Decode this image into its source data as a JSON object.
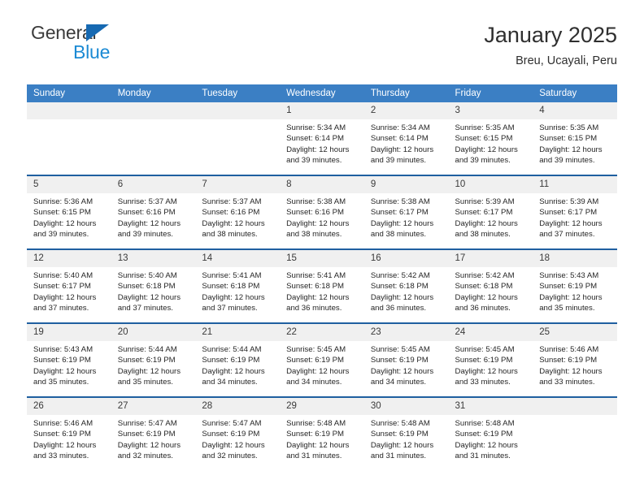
{
  "brand": {
    "name_part1": "General",
    "name_part2": "Blue",
    "triangle_color": "#1669b2",
    "blue_color": "#1b8ad4"
  },
  "header": {
    "title": "January 2025",
    "subtitle": "Breu, Ucayali, Peru"
  },
  "theme": {
    "header_blue": "#3b7fc4",
    "row_rule_blue": "#1f5fa0",
    "daynum_band": "#f0f0f0"
  },
  "weekday_headers": [
    "Sunday",
    "Monday",
    "Tuesday",
    "Wednesday",
    "Thursday",
    "Friday",
    "Saturday"
  ],
  "weeks": [
    [
      {
        "day": "",
        "sunrise": "",
        "sunset": "",
        "daylight_line1": "",
        "daylight_line2": ""
      },
      {
        "day": "",
        "sunrise": "",
        "sunset": "",
        "daylight_line1": "",
        "daylight_line2": ""
      },
      {
        "day": "",
        "sunrise": "",
        "sunset": "",
        "daylight_line1": "",
        "daylight_line2": ""
      },
      {
        "day": "1",
        "sunrise": "Sunrise: 5:34 AM",
        "sunset": "Sunset: 6:14 PM",
        "daylight_line1": "Daylight: 12 hours",
        "daylight_line2": "and 39 minutes."
      },
      {
        "day": "2",
        "sunrise": "Sunrise: 5:34 AM",
        "sunset": "Sunset: 6:14 PM",
        "daylight_line1": "Daylight: 12 hours",
        "daylight_line2": "and 39 minutes."
      },
      {
        "day": "3",
        "sunrise": "Sunrise: 5:35 AM",
        "sunset": "Sunset: 6:15 PM",
        "daylight_line1": "Daylight: 12 hours",
        "daylight_line2": "and 39 minutes."
      },
      {
        "day": "4",
        "sunrise": "Sunrise: 5:35 AM",
        "sunset": "Sunset: 6:15 PM",
        "daylight_line1": "Daylight: 12 hours",
        "daylight_line2": "and 39 minutes."
      }
    ],
    [
      {
        "day": "5",
        "sunrise": "Sunrise: 5:36 AM",
        "sunset": "Sunset: 6:15 PM",
        "daylight_line1": "Daylight: 12 hours",
        "daylight_line2": "and 39 minutes."
      },
      {
        "day": "6",
        "sunrise": "Sunrise: 5:37 AM",
        "sunset": "Sunset: 6:16 PM",
        "daylight_line1": "Daylight: 12 hours",
        "daylight_line2": "and 39 minutes."
      },
      {
        "day": "7",
        "sunrise": "Sunrise: 5:37 AM",
        "sunset": "Sunset: 6:16 PM",
        "daylight_line1": "Daylight: 12 hours",
        "daylight_line2": "and 38 minutes."
      },
      {
        "day": "8",
        "sunrise": "Sunrise: 5:38 AM",
        "sunset": "Sunset: 6:16 PM",
        "daylight_line1": "Daylight: 12 hours",
        "daylight_line2": "and 38 minutes."
      },
      {
        "day": "9",
        "sunrise": "Sunrise: 5:38 AM",
        "sunset": "Sunset: 6:17 PM",
        "daylight_line1": "Daylight: 12 hours",
        "daylight_line2": "and 38 minutes."
      },
      {
        "day": "10",
        "sunrise": "Sunrise: 5:39 AM",
        "sunset": "Sunset: 6:17 PM",
        "daylight_line1": "Daylight: 12 hours",
        "daylight_line2": "and 38 minutes."
      },
      {
        "day": "11",
        "sunrise": "Sunrise: 5:39 AM",
        "sunset": "Sunset: 6:17 PM",
        "daylight_line1": "Daylight: 12 hours",
        "daylight_line2": "and 37 minutes."
      }
    ],
    [
      {
        "day": "12",
        "sunrise": "Sunrise: 5:40 AM",
        "sunset": "Sunset: 6:17 PM",
        "daylight_line1": "Daylight: 12 hours",
        "daylight_line2": "and 37 minutes."
      },
      {
        "day": "13",
        "sunrise": "Sunrise: 5:40 AM",
        "sunset": "Sunset: 6:18 PM",
        "daylight_line1": "Daylight: 12 hours",
        "daylight_line2": "and 37 minutes."
      },
      {
        "day": "14",
        "sunrise": "Sunrise: 5:41 AM",
        "sunset": "Sunset: 6:18 PM",
        "daylight_line1": "Daylight: 12 hours",
        "daylight_line2": "and 37 minutes."
      },
      {
        "day": "15",
        "sunrise": "Sunrise: 5:41 AM",
        "sunset": "Sunset: 6:18 PM",
        "daylight_line1": "Daylight: 12 hours",
        "daylight_line2": "and 36 minutes."
      },
      {
        "day": "16",
        "sunrise": "Sunrise: 5:42 AM",
        "sunset": "Sunset: 6:18 PM",
        "daylight_line1": "Daylight: 12 hours",
        "daylight_line2": "and 36 minutes."
      },
      {
        "day": "17",
        "sunrise": "Sunrise: 5:42 AM",
        "sunset": "Sunset: 6:18 PM",
        "daylight_line1": "Daylight: 12 hours",
        "daylight_line2": "and 36 minutes."
      },
      {
        "day": "18",
        "sunrise": "Sunrise: 5:43 AM",
        "sunset": "Sunset: 6:19 PM",
        "daylight_line1": "Daylight: 12 hours",
        "daylight_line2": "and 35 minutes."
      }
    ],
    [
      {
        "day": "19",
        "sunrise": "Sunrise: 5:43 AM",
        "sunset": "Sunset: 6:19 PM",
        "daylight_line1": "Daylight: 12 hours",
        "daylight_line2": "and 35 minutes."
      },
      {
        "day": "20",
        "sunrise": "Sunrise: 5:44 AM",
        "sunset": "Sunset: 6:19 PM",
        "daylight_line1": "Daylight: 12 hours",
        "daylight_line2": "and 35 minutes."
      },
      {
        "day": "21",
        "sunrise": "Sunrise: 5:44 AM",
        "sunset": "Sunset: 6:19 PM",
        "daylight_line1": "Daylight: 12 hours",
        "daylight_line2": "and 34 minutes."
      },
      {
        "day": "22",
        "sunrise": "Sunrise: 5:45 AM",
        "sunset": "Sunset: 6:19 PM",
        "daylight_line1": "Daylight: 12 hours",
        "daylight_line2": "and 34 minutes."
      },
      {
        "day": "23",
        "sunrise": "Sunrise: 5:45 AM",
        "sunset": "Sunset: 6:19 PM",
        "daylight_line1": "Daylight: 12 hours",
        "daylight_line2": "and 34 minutes."
      },
      {
        "day": "24",
        "sunrise": "Sunrise: 5:45 AM",
        "sunset": "Sunset: 6:19 PM",
        "daylight_line1": "Daylight: 12 hours",
        "daylight_line2": "and 33 minutes."
      },
      {
        "day": "25",
        "sunrise": "Sunrise: 5:46 AM",
        "sunset": "Sunset: 6:19 PM",
        "daylight_line1": "Daylight: 12 hours",
        "daylight_line2": "and 33 minutes."
      }
    ],
    [
      {
        "day": "26",
        "sunrise": "Sunrise: 5:46 AM",
        "sunset": "Sunset: 6:19 PM",
        "daylight_line1": "Daylight: 12 hours",
        "daylight_line2": "and 33 minutes."
      },
      {
        "day": "27",
        "sunrise": "Sunrise: 5:47 AM",
        "sunset": "Sunset: 6:19 PM",
        "daylight_line1": "Daylight: 12 hours",
        "daylight_line2": "and 32 minutes."
      },
      {
        "day": "28",
        "sunrise": "Sunrise: 5:47 AM",
        "sunset": "Sunset: 6:19 PM",
        "daylight_line1": "Daylight: 12 hours",
        "daylight_line2": "and 32 minutes."
      },
      {
        "day": "29",
        "sunrise": "Sunrise: 5:48 AM",
        "sunset": "Sunset: 6:19 PM",
        "daylight_line1": "Daylight: 12 hours",
        "daylight_line2": "and 31 minutes."
      },
      {
        "day": "30",
        "sunrise": "Sunrise: 5:48 AM",
        "sunset": "Sunset: 6:19 PM",
        "daylight_line1": "Daylight: 12 hours",
        "daylight_line2": "and 31 minutes."
      },
      {
        "day": "31",
        "sunrise": "Sunrise: 5:48 AM",
        "sunset": "Sunset: 6:19 PM",
        "daylight_line1": "Daylight: 12 hours",
        "daylight_line2": "and 31 minutes."
      },
      {
        "day": "",
        "sunrise": "",
        "sunset": "",
        "daylight_line1": "",
        "daylight_line2": ""
      }
    ]
  ]
}
